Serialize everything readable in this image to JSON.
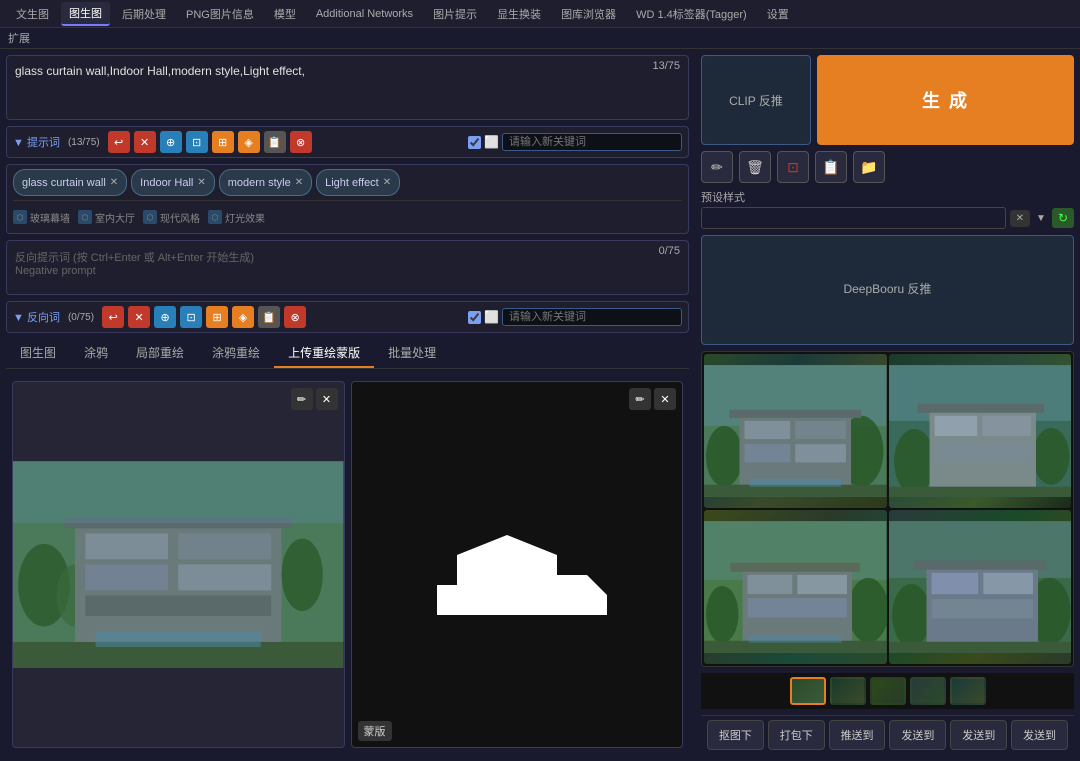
{
  "nav": {
    "tabs": [
      {
        "label": "文生图",
        "active": false
      },
      {
        "label": "图生图",
        "active": true
      },
      {
        "label": "后期处理",
        "active": false
      },
      {
        "label": "PNG图片信息",
        "active": false
      },
      {
        "label": "模型",
        "active": false
      },
      {
        "label": "Additional Networks",
        "active": false
      },
      {
        "label": "图片提示",
        "active": false
      },
      {
        "label": "显生换装",
        "active": false
      },
      {
        "label": "图库浏览器",
        "active": false
      },
      {
        "label": "WD 1.4标签器(Tagger)",
        "active": false
      },
      {
        "label": "设置",
        "active": false
      }
    ],
    "expand": "扩展"
  },
  "prompt": {
    "positive": {
      "text": "glass curtain wall,Indoor Hall,modern style,Light effect,",
      "counter": "13/75",
      "label": "提示词",
      "count_label": "(13/75)",
      "keyword_placeholder": "请输入新关键词"
    },
    "tags": [
      {
        "text": "glass curtain wall",
        "sub": "玻璃幕墙"
      },
      {
        "text": "Indoor Hall",
        "sub": "室内大厅"
      },
      {
        "text": "modern style",
        "sub": "现代风格"
      },
      {
        "text": "Light effect",
        "sub": "灯光效果"
      }
    ],
    "negative": {
      "text": "",
      "placeholder_line1": "反向提示词 (按 Ctrl+Enter 或 Alt+Enter 开始生成)",
      "placeholder_line2": "Negative prompt",
      "counter": "0/75",
      "label": "反向词",
      "count_label": "(0/75)",
      "keyword_placeholder": "请输入新关键词"
    }
  },
  "toolbar_buttons": {
    "icons": [
      "⟲",
      "✕",
      "☆",
      "⊕",
      "⊡",
      "⊞",
      "◈",
      "⊗"
    ]
  },
  "right_panel": {
    "clip": {
      "label": "CLIP 反推"
    },
    "generate_btn": "生 成",
    "action_icons": [
      "✏",
      "🗑",
      "⊡",
      "📋",
      "📁"
    ],
    "preset": {
      "label": "预设样式",
      "placeholder": "",
      "clear": "✕",
      "refresh": "↻"
    },
    "deepbooru": {
      "label": "DeepBooru 反推"
    }
  },
  "bottom_tabs": [
    {
      "label": "图生图",
      "active": false
    },
    {
      "label": "涂鸦",
      "active": false
    },
    {
      "label": "局部重绘",
      "active": false
    },
    {
      "label": "涂鸦重绘",
      "active": false
    },
    {
      "label": "上传重绘蒙版",
      "active": true
    },
    {
      "label": "批量处理",
      "active": false
    }
  ],
  "canvas_panels": [
    {
      "label": null,
      "has_image": true
    },
    {
      "label": "蒙版",
      "has_image": true
    }
  ],
  "images_grid": {
    "count": 4,
    "thumbnails": 5,
    "selected_thumb": 0
  },
  "bottom_actions": [
    {
      "label": "抠图下"
    },
    {
      "label": "打包下"
    },
    {
      "label": "推送到"
    },
    {
      "label": "发送到"
    },
    {
      "label": "发送到"
    },
    {
      "label": "发送到"
    }
  ]
}
